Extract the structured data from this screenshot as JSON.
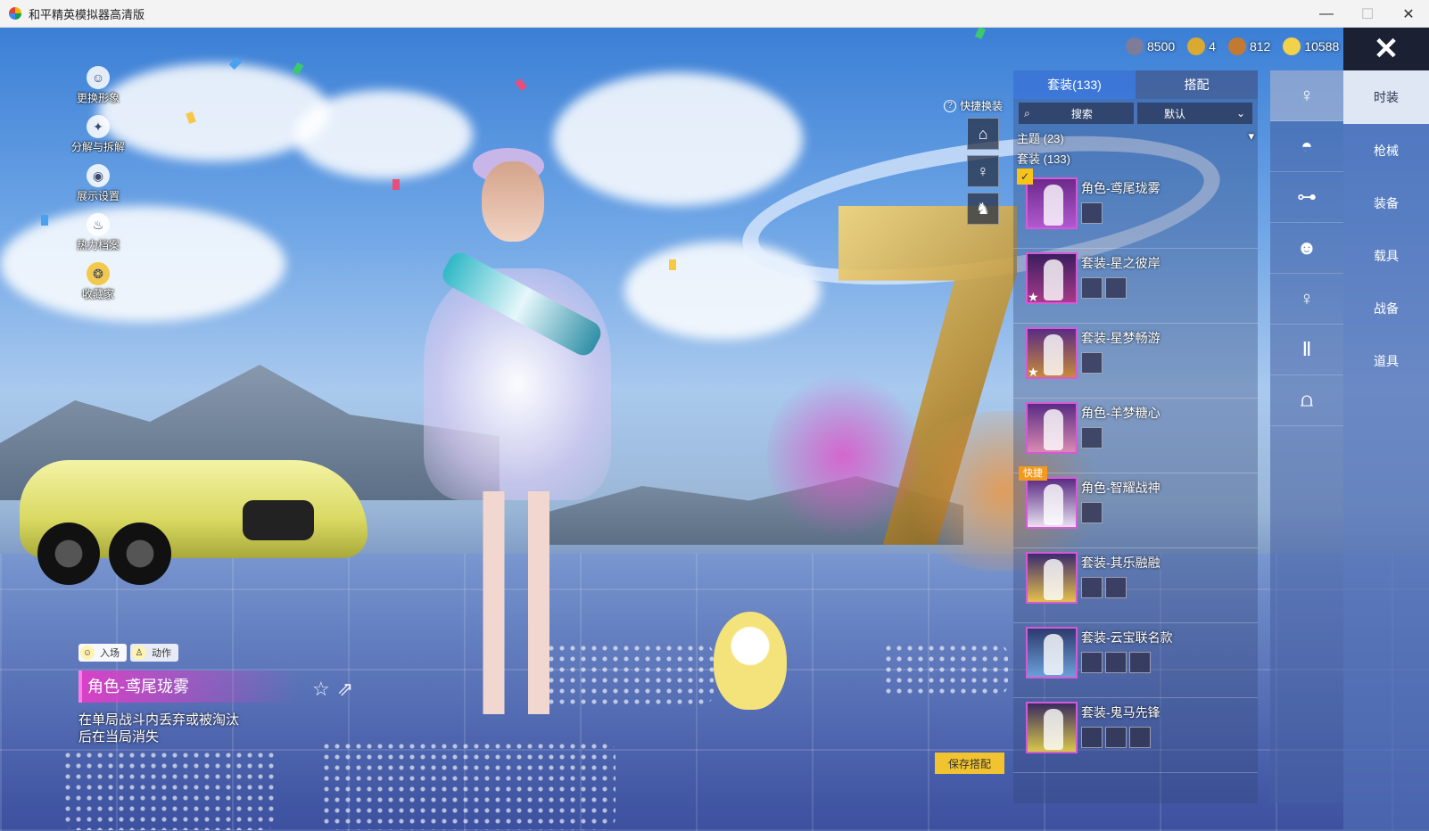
{
  "window": {
    "title": "和平精英模拟器高清版",
    "minimize_glyph": "—",
    "maximize_glyph": "☐",
    "close_glyph": "✕"
  },
  "left_menu": [
    {
      "label": "更换形象",
      "icon": "avatar-icon",
      "glyph": "☺"
    },
    {
      "label": "分解与拆解",
      "icon": "puzzle-icon",
      "glyph": "✦"
    },
    {
      "label": "展示设置",
      "icon": "eye-icon",
      "glyph": "◉"
    },
    {
      "label": "热力档案",
      "icon": "flame-icon",
      "glyph": "♨"
    },
    {
      "label": "收藏家",
      "icon": "collector-icon",
      "glyph": "❂"
    }
  ],
  "motion_tabs": [
    {
      "label": "入场",
      "icon": "entrance-icon"
    },
    {
      "label": "动作",
      "icon": "action-icon"
    }
  ],
  "current_skin": {
    "name": "角色-鸢尾珑雾",
    "description": "在单局战斗内丢弃或被淘汰后在当局消失"
  },
  "currency": [
    {
      "value": "8500",
      "color": "#7d7d9a",
      "icon": "silver-coin-icon"
    },
    {
      "value": "4",
      "color": "#d9a932",
      "icon": "rank-token-icon"
    },
    {
      "value": "812",
      "color": "#c27a33",
      "icon": "bronze-coin-icon"
    },
    {
      "value": "10588",
      "color": "#f2d24a",
      "icon": "gold-coupon-icon"
    }
  ],
  "quick_change": {
    "label": "快捷换装",
    "slots": [
      "hanger-icon",
      "outfit-slot-icon",
      "outfit-slot-icon"
    ]
  },
  "outfit_panel": {
    "tabs": [
      "套装(133)",
      "搭配"
    ],
    "search_placeholder": "搜索",
    "sort": "默认",
    "theme_row": "主题 (23)",
    "suit_row": "套装 (133)",
    "items": [
      {
        "name": "角色-鸢尾珑雾",
        "parts": 1,
        "thumb_colors": [
          "#5a2b84",
          "#c26ad6"
        ],
        "selected": true
      },
      {
        "name": "套装-星之彼岸",
        "parts": 2,
        "thumb_colors": [
          "#3b1e5e",
          "#a63a8a"
        ],
        "star": true
      },
      {
        "name": "套装-星梦畅游",
        "parts": 1,
        "thumb_colors": [
          "#5a2b84",
          "#c88a3a"
        ],
        "star": true
      },
      {
        "name": "角色-羊梦糖心",
        "parts": 1,
        "thumb_colors": [
          "#5a2b84",
          "#d98ab0"
        ]
      },
      {
        "name": "角色-智耀战神",
        "parts": 1,
        "thumb_colors": [
          "#5a2b84",
          "#e8e0f0"
        ],
        "badge": "快捷"
      },
      {
        "name": "套装-其乐融融",
        "parts": 2,
        "thumb_colors": [
          "#3b2b6e",
          "#e6c04a"
        ]
      },
      {
        "name": "套装-云宝联名款",
        "parts": 3,
        "thumb_colors": [
          "#2c3a6e",
          "#6aa0d8"
        ]
      },
      {
        "name": "套装-鬼马先锋",
        "parts": 3,
        "thumb_colors": [
          "#3b2b5e",
          "#d8c84a"
        ]
      }
    ]
  },
  "save_button": "保存搭配",
  "slot_column": [
    {
      "icon": "figure-icon",
      "glyph": "♀",
      "active": true
    },
    {
      "icon": "cap-icon",
      "glyph": "◓"
    },
    {
      "icon": "glasses-icon",
      "glyph": "⊶"
    },
    {
      "icon": "mask-icon",
      "glyph": "☻"
    },
    {
      "icon": "top-icon",
      "glyph": "♀"
    },
    {
      "icon": "pants-icon",
      "glyph": "Ⅱ"
    },
    {
      "icon": "shoes-icon",
      "glyph": "⩍"
    }
  ],
  "category_column": {
    "close_glyph": "✕",
    "items": [
      {
        "label": "时装",
        "active": true
      },
      {
        "label": "枪械"
      },
      {
        "label": "装备"
      },
      {
        "label": "载具"
      },
      {
        "label": "战备"
      },
      {
        "label": "道具"
      }
    ]
  }
}
